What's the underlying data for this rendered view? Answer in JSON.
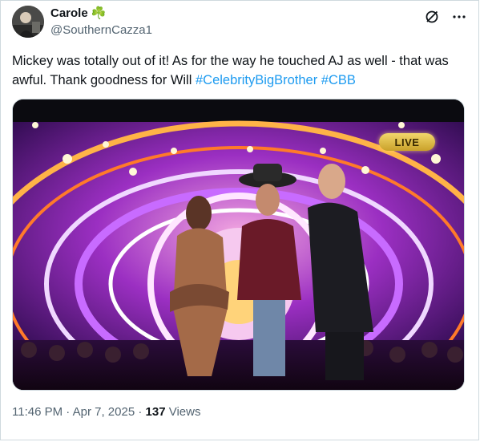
{
  "author": {
    "name": "Carole",
    "emoji": "☘️",
    "handle": "@SouthernCazza1"
  },
  "tweet": {
    "text_plain": "Mickey was totally out of it! As for the way he touched AJ as well - that was awful. Thank goodness for Will ",
    "hashtags": [
      "#CelebrityBigBrother",
      "#CBB"
    ]
  },
  "media": {
    "badge": "LIVE"
  },
  "meta": {
    "time": "11:46 PM",
    "separator": "·",
    "date": "Apr 7, 2025",
    "views_count": "137",
    "views_label": "Views"
  },
  "icons": {
    "grok": "grok-icon",
    "more": "more-icon"
  },
  "colors": {
    "link": "#1d9bf0",
    "secondary_text": "#536471",
    "border": "#cfd9de"
  }
}
